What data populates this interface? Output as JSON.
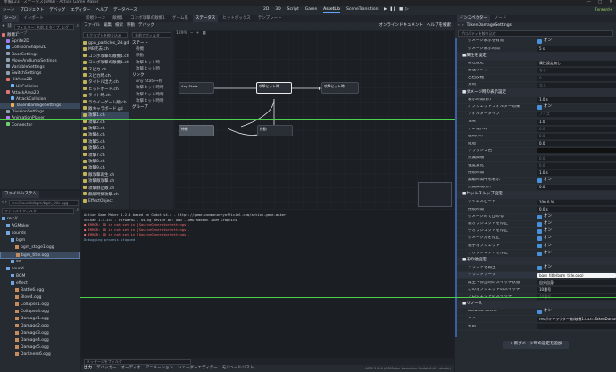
{
  "titlebar": {
    "text": "準備123 - ステータス(6MB) - Action Game Maker",
    "min": "—",
    "max": "□",
    "close": "✕"
  },
  "menu": [
    "シーン",
    "プロジェクト",
    "デバッグ",
    "エディター",
    "ヘルプ",
    "データベース"
  ],
  "workspaces": [
    "2D",
    "3D",
    "Script",
    "Game",
    "AssetLib",
    "SceneTransition"
  ],
  "active_workspace": "AssetLib",
  "renderer": "Forward+",
  "scene_dock": {
    "tabs": [
      "シーン",
      "インポート"
    ],
    "filter_placeholder": "フィルター: 名前, t:タイプ, g:グループ",
    "tree": [
      {
        "label": "敵機1",
        "indent": 0,
        "color": "#e57373"
      },
      {
        "label": "Sprite2D",
        "indent": 1,
        "color": "#9b7ff0"
      },
      {
        "label": "CollisionShape2D",
        "indent": 1,
        "color": "#6fb6ff"
      },
      {
        "label": "BaseSettings",
        "indent": 1,
        "color": "#8fa0b0"
      },
      {
        "label": "MoveAndJumpSettings",
        "indent": 1,
        "color": "#8fa0b0"
      },
      {
        "label": "VariableSettings",
        "indent": 1,
        "color": "#8fa0b0"
      },
      {
        "label": "SwitchSettings",
        "indent": 1,
        "color": "#8fa0b0"
      },
      {
        "label": "HitArea2D",
        "indent": 1,
        "color": "#e57373"
      },
      {
        "label": "HitCollision",
        "indent": 2,
        "color": "#6fb6ff"
      },
      {
        "label": "AttackArea2D",
        "indent": 1,
        "color": "#e57373"
      },
      {
        "label": "AttackCollision",
        "indent": 2,
        "color": "#6fb6ff"
      },
      {
        "label": "TakenDamageSettings",
        "indent": 2,
        "color": "#f0b24a",
        "selected": true
      },
      {
        "label": "DivisionSettings",
        "indent": 1,
        "color": "#8fa0b0"
      },
      {
        "label": "AnimationPlayer",
        "indent": 1,
        "color": "#c07ff0"
      },
      {
        "label": "Connector",
        "indent": 1,
        "color": "#6fd06f"
      }
    ]
  },
  "fs_dock": {
    "title": "ファイルシステム",
    "path": "res://sounds/bgm/bgm_title.ogg",
    "filter_placeholder": "ファイルをフィルタ",
    "items": [
      {
        "label": "res://",
        "indent": 0,
        "folder": true
      },
      {
        "label": "AGMaker",
        "indent": 1,
        "folder": true
      },
      {
        "label": "sounds",
        "indent": 1,
        "folder": true
      },
      {
        "label": "bgm",
        "indent": 2,
        "folder": true
      },
      {
        "label": "bgm_stage1.ogg",
        "indent": 3
      },
      {
        "label": "bgm_title.ogg",
        "indent": 3,
        "selected": true
      },
      {
        "label": "se",
        "indent": 2,
        "folder": true
      },
      {
        "label": "sound",
        "indent": 1,
        "folder": true
      },
      {
        "label": "BGM",
        "indent": 2,
        "folder": true
      },
      {
        "label": "effect",
        "indent": 2,
        "folder": true
      },
      {
        "label": "Battle6.ogg",
        "indent": 3
      },
      {
        "label": "Blow4.ogg",
        "indent": 3
      },
      {
        "label": "Collapse1.ogg",
        "indent": 3
      },
      {
        "label": "Collapse4.ogg",
        "indent": 3
      },
      {
        "label": "Damage1.ogg",
        "indent": 3
      },
      {
        "label": "Damage2.ogg",
        "indent": 3
      },
      {
        "label": "Damage3.ogg",
        "indent": 3
      },
      {
        "label": "Damage4.ogg",
        "indent": 3
      },
      {
        "label": "Damage5.ogg",
        "indent": 3
      },
      {
        "label": "Darkness6.ogg",
        "indent": 3
      }
    ]
  },
  "center": {
    "tabs": [
      "新規シーン",
      "敵機1",
      "コンボ攻撃の敵機1",
      "ゲーム系",
      "ステータス",
      "ヒットボックス",
      "テンプレート"
    ],
    "toolbar": {
      "zoom": "129%",
      "online": "オンラインドキュメント",
      "help": "ヘルプを検索"
    },
    "script_menu": [
      "ファイル",
      "編集",
      "検索",
      "移動",
      "デバッグ"
    ],
    "script_filter": "スクリプトを絞り込み",
    "scripts": [
      "gpu_particles_2d.gd",
      "MB死去.ch",
      "コンボ攻撃の敵機1.ch",
      "コンボ攻撃の敵機1.ch",
      "スピカ.ch",
      "スピカ時.ch",
      "タイトル出力.ch",
      "ヒットボード.ch",
      "ライト時.ch",
      "ラウイーゲーム敵.ch",
      "敵キャラボード.gd",
      "攻撃1.ch",
      "攻撃2.ch",
      "攻撃3.ch",
      "攻撃4.ch",
      "攻撃5.ch",
      "攻撃6.ch",
      "攻撃7.ch",
      "攻撃8.ch",
      "攻撃9.ch",
      "敵攻撃再生.ch",
      "攻撃敵攻撃.ch",
      "攻撃静止敵.ch",
      "無敵時間攻撃.ch",
      "EffectObject"
    ],
    "selected_script": 11,
    "vs_filter": "名前でフィルタ",
    "vs_groups": [
      {
        "title": "ステート",
        "items": [
          "待機",
          "移動",
          "攻撃ヒット時",
          "攻撃ヒット時"
        ]
      },
      {
        "title": "リンク",
        "items": [
          "Any State→移",
          "攻撃ヒット時時",
          "攻撃ヒット時時",
          "攻撃ヒット時時"
        ]
      },
      {
        "title": "グループ",
        "items": []
      }
    ],
    "graph_nodes": [
      {
        "label": "Any State",
        "style": "dark"
      },
      {
        "label": "攻撃ヒット時",
        "style": "light"
      },
      {
        "label": "攻撃ヒット時",
        "style": "dark"
      },
      {
        "label": "待機",
        "style": "gray"
      },
      {
        "label": "移動",
        "style": "dark"
      }
    ]
  },
  "output": {
    "lines": [
      {
        "text": "Action Game Maker 1.2.4 based on Godot v4.4 - https://game.commonarryofficial.com/action-game-maker",
        "c": "#c9ccd1"
      },
      {
        "text": "Vulkan 1.4.331 - Forward+ - Using Device #0: AMD - AMD Radeon 780M Graphics",
        "c": "#c9ccd1"
      },
      {
        "text": "● ERROR: ID is not set in [SourceGeneratorSettings].",
        "c": "#ef6b6b"
      },
      {
        "text": "● ERROR: ID is not set in [SourceGeneratorSettings].",
        "c": "#ef6b6b"
      },
      {
        "text": "● ERROR: ID is not set in [SourceGeneratorSettings].",
        "c": "#ef6b6b"
      },
      {
        "text": "    Debugging process stopped",
        "c": "#7fa0c0"
      }
    ],
    "filter_placeholder": "メッセージをフィルタ",
    "bottom_tabs": [
      "出力",
      "デバッガー",
      "オーディオ",
      "アニメーション",
      "シェーダーエディター",
      "モジュールリスト"
    ],
    "version": "AGM 1.2.4 (AGMaker based on Godot 4.4.1 stable)"
  },
  "inspector": {
    "tabs": [
      "インスペクター",
      "ノード"
    ],
    "object": "TakenDamageSettings",
    "filter_placeholder": "プロパティを絞り込む",
    "rows": [
      {
        "t": "prop",
        "label": "ダメージ表示を有効",
        "kind": "check",
        "value": "オン"
      },
      {
        "t": "prop",
        "label": "ダメージ表示時間",
        "value": "5 s"
      },
      {
        "t": "sec",
        "label": "■属性を設定"
      },
      {
        "t": "prop",
        "label": "属性設定",
        "value": "属性設定無し"
      },
      {
        "t": "prop",
        "label": "属性タイプ",
        "value": "なし",
        "dim": true
      },
      {
        "t": "prop",
        "label": "左右反転",
        "value": "0",
        "dim": true
      },
      {
        "t": "prop",
        "label": "方向",
        "value": "なし",
        "dim": true
      },
      {
        "t": "sec",
        "label": "■ダメージ時の表示設定"
      },
      {
        "t": "prop",
        "label": "表示時間(秒)",
        "value": "1.0 s"
      },
      {
        "t": "prop",
        "label": "オブジェクトフィルター効果",
        "kind": "check",
        "value": "オン"
      },
      {
        "t": "prop",
        "label": "フィルタータイプ",
        "value": "ノイズ",
        "dim": true
      },
      {
        "t": "prop",
        "label": "強度",
        "value": "1.0"
      },
      {
        "t": "prop",
        "label": "ブレ幅(%)",
        "value": "0.0",
        "dim": true
      },
      {
        "t": "prop",
        "label": "強制(%)",
        "value": "0.0",
        "dim": true
      },
      {
        "t": "prop",
        "label": "透過",
        "value": "0.0"
      },
      {
        "t": "prop",
        "label": "フラッシュ色",
        "value": "",
        "swatch": "#111111"
      },
      {
        "t": "prop",
        "label": "点滅間隔",
        "value": "0.0",
        "dim": true
      },
      {
        "t": "prop",
        "label": "強度変化",
        "value": "0.0",
        "dim": true
      },
      {
        "t": "prop",
        "label": "持続時間",
        "value": "1.0 s"
      },
      {
        "t": "prop",
        "label": "無敵時間中も表示",
        "kind": "check",
        "value": "オン"
      },
      {
        "t": "prop",
        "label": "点滅間隔(秒)",
        "value": "0.0"
      },
      {
        "t": "sec",
        "label": "■ヒットストップ設定"
      },
      {
        "t": "prop",
        "label": "タイムスピード",
        "value": "100.0 %"
      },
      {
        "t": "prop",
        "label": "持続時間",
        "value": "0.0 s"
      },
      {
        "t": "prop",
        "label": "ダメージ時で止める",
        "kind": "check",
        "value": "オン"
      },
      {
        "t": "prop",
        "label": "親オブジェクトを停止",
        "kind": "check",
        "value": "オン"
      },
      {
        "t": "prop",
        "label": "子オブジェクトを停止",
        "kind": "check",
        "value": "オン"
      },
      {
        "t": "prop",
        "label": "ダメージ元を停止",
        "kind": "check",
        "value": "オン"
      },
      {
        "t": "prop",
        "label": "親子オブジェクト",
        "kind": "check",
        "value": "オン"
      },
      {
        "t": "prop",
        "label": "子オブジェクトを停止",
        "kind": "check",
        "value": "オン"
      },
      {
        "t": "sec",
        "label": "■その他設定"
      },
      {
        "t": "prop",
        "label": "サウンドを再生",
        "kind": "check",
        "value": "オン"
      },
      {
        "t": "prop",
        "label": "サウンドデータ",
        "value": "bgm_title(bgm_title.ogg)",
        "hl": true
      },
      {
        "t": "prop",
        "label": "再生・停止時のスイッチ状態",
        "value": "自分自身"
      },
      {
        "t": "prop",
        "label": "このオブジェクトのスイッチ",
        "value": "10番号"
      },
      {
        "t": "prop",
        "label": "プロジェクトのスイッチ",
        "value": "10番号",
        "dim": true
      },
      {
        "t": "sec",
        "label": "■リソース"
      },
      {
        "t": "prop",
        "label": "Local to Scene",
        "kind": "check",
        "value": "オン"
      },
      {
        "t": "prop",
        "label": "パス",
        "value": "res://キャラクター敵/敵機1.tscn::TakenDamageSettings"
      },
      {
        "t": "prop",
        "label": "名前",
        "value": ""
      }
    ],
    "add_button": "+ 新ダメージ時の設定を追加"
  }
}
